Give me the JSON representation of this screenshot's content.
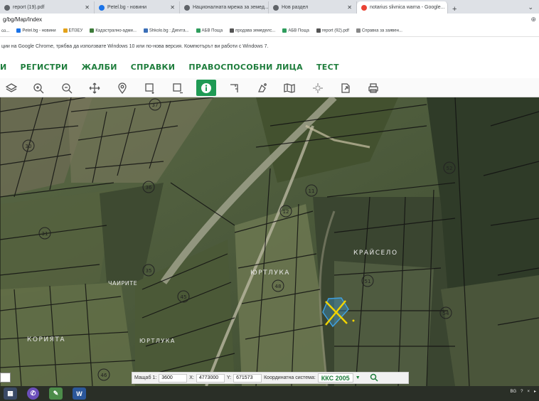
{
  "browser": {
    "tabs": [
      {
        "title": "report (19).pdf",
        "active": false
      },
      {
        "title": "Petel.bg - новини",
        "active": false
      },
      {
        "title": "Националната мрежа за земед...",
        "active": false
      },
      {
        "title": "Нов раздел",
        "active": false
      },
      {
        "title": "notarius slivnica warna - Google...",
        "active": true
      }
    ],
    "new_tab_symbol": "+",
    "url": "g/bg/Map/Index",
    "zoom_symbol": "⊕",
    "bookmarks": [
      "co...",
      "Petel.bg - новини",
      "ЕПЗЕУ",
      "Кадастрално-адми...",
      "Shkolo.bg : Дигита...",
      "АБВ Поща",
      "продава земеделс...",
      "АБВ Поща",
      "report (92).pdf",
      "Справка за заявен..."
    ],
    "notice": "ции на Google Chrome, трябва да използвате Windows 10 или по-нова версия. Компютърът ви работи с Windows 7."
  },
  "menu": [
    "И",
    "РЕГИСТРИ",
    "ЖАЛБИ",
    "СПРАВКИ",
    "ПРАВОСПОСОБНИ ЛИЦА",
    "ТЕСТ"
  ],
  "toolbar": {
    "tools": [
      "layers-icon",
      "zoom-in-icon",
      "zoom-out-icon",
      "pan-icon",
      "marker-icon",
      "select-plus-icon",
      "select-minus-icon",
      "info-icon",
      "measure-icon",
      "draw-icon",
      "map-icon",
      "crosshair-icon",
      "export-icon",
      "print-icon"
    ],
    "active_tool": "info-icon",
    "active_color": "#1f9a54"
  },
  "map": {
    "parcel_numbers": [
      "37",
      "30",
      "36",
      "31",
      "35",
      "45",
      "46",
      "48",
      "11",
      "12",
      "52",
      "54",
      "51"
    ],
    "place_labels": [
      "КРАЙСЕЛО",
      "ЮРТЛУКА",
      "ЧАИРИТЕ",
      "КОРИЯТА",
      "ЮРТЛУКА"
    ]
  },
  "status": {
    "scale_label": "Мащаб 1:",
    "scale_value": "3600",
    "x_label": "X:",
    "x_value": "4773000",
    "y_label": "Y:",
    "y_value": "671573",
    "system_label": "Координатна система:",
    "system_value": "ККС 2005",
    "dropdown_symbol": "▼"
  },
  "taskbar": {
    "apps": [
      "explorer-icon",
      "viber-icon",
      "paint-icon",
      "word-icon"
    ],
    "tray": [
      "BG",
      "?",
      "×",
      "▸"
    ]
  }
}
